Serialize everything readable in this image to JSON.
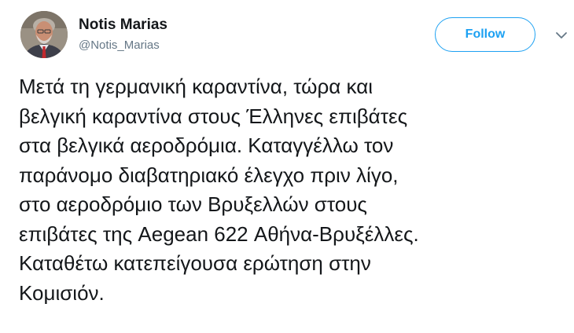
{
  "author": {
    "display_name": "Notis Marias",
    "handle": "@Notis_Marias",
    "avatar_icon": "profile-photo-avatar"
  },
  "actions": {
    "follow_label": "Follow",
    "menu_icon": "chevron-down-icon"
  },
  "tweet": {
    "text": "Μετά τη γερμανική καραντίνα, τώρα και\nβελγική καραντίνα στους Έλληνες επιβάτες\nστα βελγικά αεροδρόμια. Καταγγέλλω τον\nπαράνομο διαβατηριακό έλεγχο πριν λίγο,\nστο αεροδρόμιο των Βρυξελλών στους\nεπιβάτες της Aegean 622 Αθήνα-Βρυξέλλες.\nΚαταθέτω κατεπείγουσα ερώτηση στην\nΚομισιόν."
  },
  "colors": {
    "accent": "#1da1f2",
    "text": "#14171a",
    "muted": "#657786"
  }
}
